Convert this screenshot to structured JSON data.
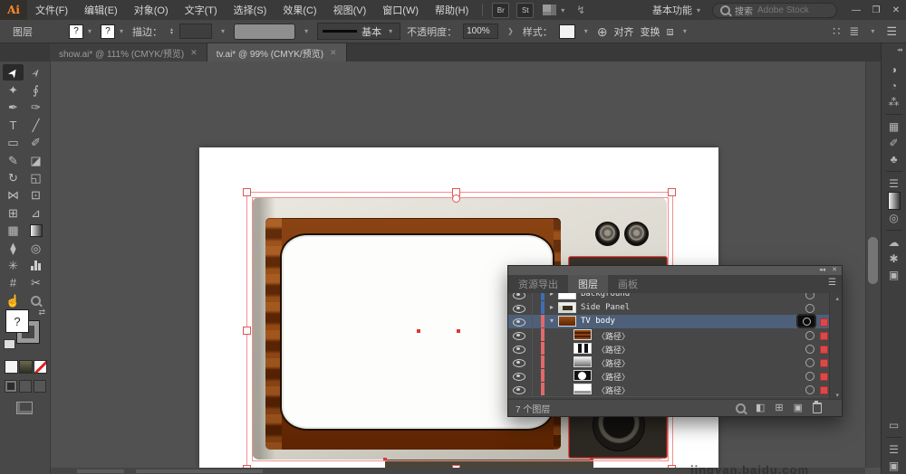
{
  "menu_bar": {
    "logo": "Ai",
    "menus": [
      "文件(F)",
      "编辑(E)",
      "对象(O)",
      "文字(T)",
      "选择(S)",
      "效果(C)",
      "视图(V)",
      "窗口(W)",
      "帮助(H)"
    ],
    "bridge_badge": "Br",
    "stock_badge": "St",
    "workspace": "基本功能",
    "search_label": "搜索",
    "search_hint": "Adobe Stock",
    "window_controls": {
      "minimize": "—",
      "restore": "❐",
      "close": "✕"
    }
  },
  "control_bar": {
    "panel_label": "图层",
    "fill_value": "?",
    "stroke_swatch_value": "?",
    "stroke_label": "描边：",
    "stroke_style": "基本",
    "opacity_label": "不透明度：",
    "opacity_value": "100%",
    "more_arrow": "❯",
    "style_label": "样式：",
    "align_label": "对齐",
    "transform_label": "变换"
  },
  "document_tabs": [
    {
      "label": "show.ai* @ 111% (CMYK/预览)",
      "close": "✕",
      "active": false
    },
    {
      "label": "tv.ai* @ 99% (CMYK/预览)",
      "close": "✕",
      "active": true
    }
  ],
  "toolbar": {
    "fill_value": "?",
    "tools": [
      {
        "name": "selection-tool",
        "glyph": "➤",
        "active": true
      },
      {
        "name": "direct-selection-tool",
        "glyph": "➢"
      },
      {
        "name": "magic-wand-tool",
        "glyph": "✦"
      },
      {
        "name": "lasso-tool",
        "glyph": "∮"
      },
      {
        "name": "pen-tool",
        "glyph": "✒"
      },
      {
        "name": "curvature-tool",
        "glyph": "✑"
      },
      {
        "name": "type-tool",
        "glyph": "T"
      },
      {
        "name": "line-segment-tool",
        "glyph": "╱"
      },
      {
        "name": "rectangle-tool",
        "glyph": "▭"
      },
      {
        "name": "paintbrush-tool",
        "glyph": "✐"
      },
      {
        "name": "shaper-tool",
        "glyph": "✎"
      },
      {
        "name": "eraser-tool",
        "glyph": "◪"
      },
      {
        "name": "rotate-tool",
        "glyph": "↻"
      },
      {
        "name": "scale-tool",
        "glyph": "◱"
      },
      {
        "name": "width-tool",
        "glyph": "⋈"
      },
      {
        "name": "free-transform-tool",
        "glyph": "⊡"
      },
      {
        "name": "shape-builder-tool",
        "glyph": "⊞"
      },
      {
        "name": "perspective-grid-tool",
        "glyph": "⊿"
      },
      {
        "name": "mesh-tool",
        "glyph": "▦"
      },
      {
        "name": "gradient-tool",
        "glyph": "grad"
      },
      {
        "name": "eyedropper-tool",
        "glyph": "⧫"
      },
      {
        "name": "blend-tool",
        "glyph": "◎"
      },
      {
        "name": "symbol-sprayer-tool",
        "glyph": "✳"
      },
      {
        "name": "column-graph-tool",
        "glyph": "bars"
      },
      {
        "name": "artboard-tool",
        "glyph": "#"
      },
      {
        "name": "slice-tool",
        "glyph": "✂"
      },
      {
        "name": "hand-tool",
        "glyph": "☝"
      },
      {
        "name": "zoom-tool",
        "glyph": "mag"
      }
    ]
  },
  "layers_panel": {
    "grip_collapse": "◂◂",
    "grip_close": "✕",
    "tabs": [
      {
        "label": "资源导出",
        "active": false
      },
      {
        "label": "图层",
        "active": true
      },
      {
        "label": "画板",
        "active": false
      }
    ],
    "menu_icon": "☰",
    "scroll_up": "▴",
    "scroll_down": "▾",
    "rows": [
      {
        "label": "Background",
        "kind": "layer",
        "bar": "#3d6fb4",
        "thumb": "background",
        "chev": "▸",
        "target": "ring",
        "selected": false,
        "selsq": false
      },
      {
        "label": "Side Panel",
        "kind": "layer",
        "bar": "#3d6fb4",
        "thumb": "sidepanel",
        "chev": "▸",
        "target": "ring",
        "selected": false,
        "selsq": false
      },
      {
        "label": "TV body",
        "kind": "layer",
        "bar": "#e06a6a",
        "thumb": "tvbody",
        "chev": "▾",
        "target": "box",
        "selected": true,
        "selsq": true
      },
      {
        "label": "〈路径〉",
        "kind": "path",
        "bar": "#e06a6a",
        "thumb": "wood",
        "chev": "",
        "target": "ring",
        "selected": false,
        "selsq": true
      },
      {
        "label": "〈路径〉",
        "kind": "path",
        "bar": "#e06a6a",
        "thumb": "barsth",
        "chev": "",
        "target": "ring",
        "selected": false,
        "selsq": true
      },
      {
        "label": "〈路径〉",
        "kind": "path",
        "bar": "#e06a6a",
        "thumb": "graygrad",
        "chev": "",
        "target": "ring",
        "selected": false,
        "selsq": true
      },
      {
        "label": "〈路径〉",
        "kind": "path",
        "bar": "#e06a6a",
        "thumb": "circleth",
        "chev": "",
        "target": "ring",
        "selected": false,
        "selsq": true
      },
      {
        "label": "〈路径〉",
        "kind": "path",
        "bar": "#e06a6a",
        "thumb": "whiteth",
        "chev": "",
        "target": "ring",
        "selected": false,
        "selsq": true
      }
    ],
    "status": "7 个图层",
    "bottom_icons": [
      {
        "name": "locate-object-icon",
        "glyph": "mag"
      },
      {
        "name": "make-clip-mask-icon",
        "glyph": "◧"
      },
      {
        "name": "new-sublayer-icon",
        "glyph": "⊞"
      },
      {
        "name": "new-layer-icon",
        "glyph": "▣"
      },
      {
        "name": "delete-layer-icon",
        "glyph": "trash"
      }
    ]
  },
  "right_dock": {
    "collapse": "◂◂",
    "items": [
      {
        "name": "color-icon",
        "glyph": "◑"
      },
      {
        "name": "color-guide-icon",
        "glyph": "◔"
      },
      {
        "name": "color-themes-icon",
        "glyph": "⁂"
      },
      {
        "sep": true
      },
      {
        "name": "swatches-icon",
        "glyph": "▦"
      },
      {
        "name": "brushes-icon",
        "glyph": "✐"
      },
      {
        "name": "symbols-icon",
        "glyph": "♣"
      },
      {
        "sep": true
      },
      {
        "name": "stroke-icon",
        "glyph": "☰"
      },
      {
        "name": "gradient-icon",
        "glyph": "grad"
      },
      {
        "name": "transparency-icon",
        "glyph": "◎"
      },
      {
        "sep": true
      },
      {
        "name": "cc-libraries-icon",
        "glyph": "☁"
      },
      {
        "name": "appearance-icon",
        "glyph": "✱"
      },
      {
        "name": "graphic-styles-icon",
        "glyph": "▣"
      },
      {
        "spacer": true
      },
      {
        "name": "artboards-icon",
        "glyph": "▭"
      },
      {
        "sep": true
      },
      {
        "name": "layers-icon",
        "glyph": "☰"
      },
      {
        "name": "panel-icon",
        "glyph": "▣"
      }
    ]
  },
  "status_bar": {
    "watermark": "jingyan.baidu.com"
  }
}
